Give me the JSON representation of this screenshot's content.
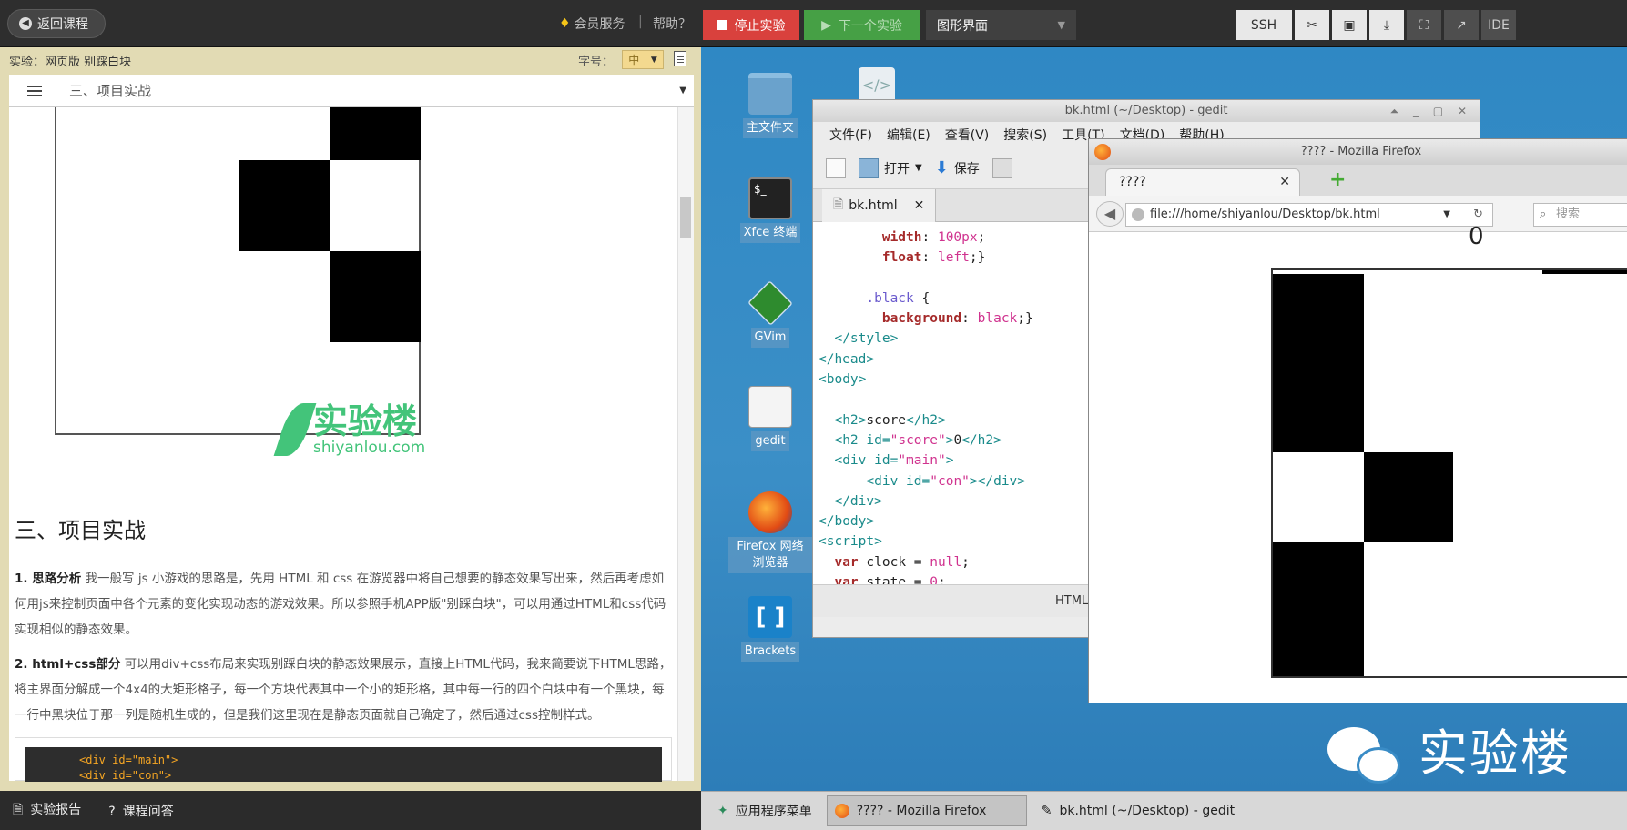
{
  "topbar": {
    "back_label": "返回课程",
    "vip_label": "会员服务",
    "separator": "|",
    "help_label": "帮助？",
    "stop_label": "停止实验",
    "next_label": "下一个实验",
    "gui_select": "图形界面",
    "tools": [
      "SSH",
      "IDE"
    ]
  },
  "left": {
    "experiment_title": "实验：网页版 别踩白块",
    "fontsize_label": "字号：",
    "fontsize_value": "中",
    "toc_current": "三、项目实战",
    "watermark_cn": "实验楼",
    "watermark_en": "shiyanlou.com",
    "section_heading": "三、项目实战",
    "para1_bold": "1. 思路分析",
    "para1_text": " 我一般写 js 小游戏的思路是，先用 HTML 和 css 在游览器中将自己想要的静态效果写出来，然后再考虑如何用js来控制页面中各个元素的变化实现动态的游戏效果。所以参照手机APP版\"别踩白块\"，可以用通过HTML和css代码实现相似的静态效果。",
    "para2_bold": "2. html+css部分",
    "para2_text": " 可以用div+css布局来实现别踩白块的静态效果展示，直接上HTML代码，我来简要说下HTML思路，将主界面分解成一个4x4的大矩形格子，每一个方块代表其中一个小的矩形格，其中每一行的四个白块中有一个黑块，每一行中黑块位于那一列是随机生成的，但是我们这里现在是静态页面就自己确定了，然后通过css控制样式。",
    "code_line1": "<div id=\"main\">",
    "code_line2": "<div id=\"con\">"
  },
  "footer": {
    "report_label": "实验报告",
    "qa_label": "课程问答"
  },
  "desktop_icons": [
    "主文件夹",
    "Xfce 终端",
    "GVim",
    "gedit",
    "Firefox 网络浏览器",
    "Brackets"
  ],
  "gedit": {
    "title": "bk.html (~/Desktop) - gedit",
    "menu": [
      "文件(F)",
      "编辑(E)",
      "查看(V)",
      "搜索(S)",
      "工具(T)",
      "文档(D)",
      "帮助(H)"
    ],
    "open_label": "打开",
    "save_label": "保存",
    "tab_label": "bk.html",
    "status_lang": "HTML"
  },
  "firefox": {
    "title": "???? - Mozilla Firefox",
    "tab_label": "????",
    "url": "file:///home/shiyanlou/Desktop/bk.html",
    "search_placeholder": "搜索",
    "score": "0"
  },
  "wechat_watermark": "实验楼",
  "taskbar": {
    "apps_menu": "应用程序菜单",
    "task_firefox": "???? - Mozilla Firefox",
    "task_gedit": "bk.html (~/Desktop) - gedit"
  },
  "colors": {
    "stop": "#d9413d",
    "next": "#46a045",
    "desktop": "#2f88c4",
    "panel_bg": "#e2dbb4",
    "accent_green": "#43c47a"
  }
}
